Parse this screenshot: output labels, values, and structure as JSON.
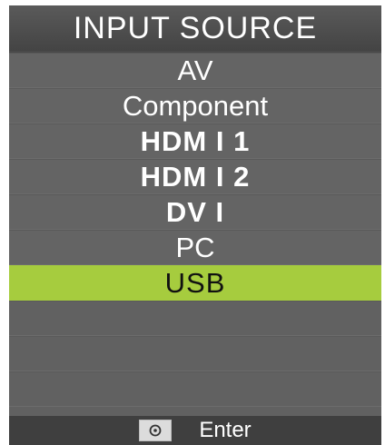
{
  "menu": {
    "title": "INPUT SOURCE",
    "items": [
      {
        "label": "AV"
      },
      {
        "label": "Component"
      },
      {
        "label": "HDM I 1"
      },
      {
        "label": "HDM I 2"
      },
      {
        "label": "DV I"
      },
      {
        "label": "PC"
      },
      {
        "label": "USB"
      }
    ],
    "selected": "USB"
  },
  "footer": {
    "icon": "ok-button-icon",
    "enter_label": "Enter"
  },
  "colors": {
    "background": "#616161",
    "header": "#4a4a4a",
    "highlight": "#a6cc3e",
    "footer": "#3f3f3f",
    "text": "#ffffff"
  }
}
